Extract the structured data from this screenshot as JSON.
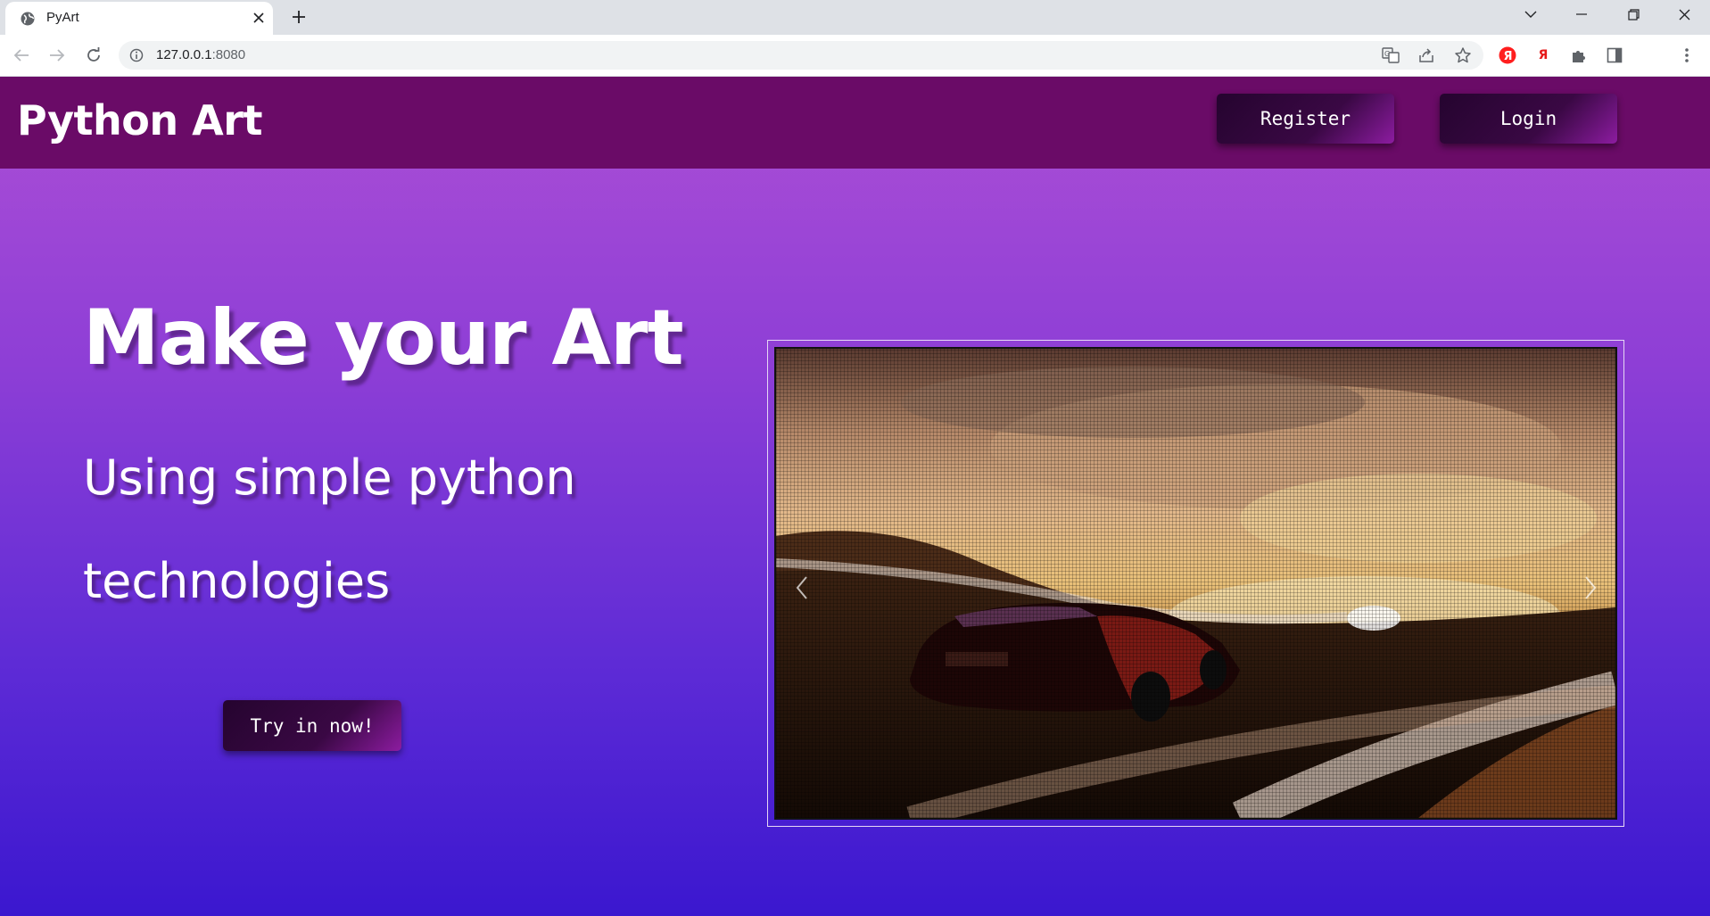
{
  "browser": {
    "tab_title": "PyArt",
    "url_host": "127.0.0.1",
    "url_port": ":8080",
    "icons": [
      "globe-icon",
      "close-icon",
      "plus-icon",
      "chevron-down-icon",
      "minimize-icon",
      "restore-icon",
      "close-window-icon",
      "back-arrow-icon",
      "forward-arrow-icon",
      "reload-icon",
      "info-icon",
      "translate-icon",
      "share-icon",
      "star-icon",
      "yandex-icon",
      "yandex-letter-icon",
      "puzzle-icon",
      "sidepanel-icon",
      "kebab-icon"
    ],
    "yandex_letter": "Я"
  },
  "navbar": {
    "brand": "Python Art",
    "register_label": "Register",
    "login_label": "Login",
    "background_color": "#6a0b67"
  },
  "hero": {
    "title": "Make your Art",
    "subtitle": "Using simple python technologies",
    "cta_label": "Try in now!"
  },
  "carousel": {
    "image_description_icon": "ascii-art-car-image",
    "prev_icon": "chevron-left-icon",
    "next_icon": "chevron-right-icon"
  },
  "colors": {
    "gradient_top": "#ad4fd5",
    "gradient_bottom": "#3b17cf",
    "button_dark": "#25042f",
    "button_accent": "#8c1ca0"
  }
}
